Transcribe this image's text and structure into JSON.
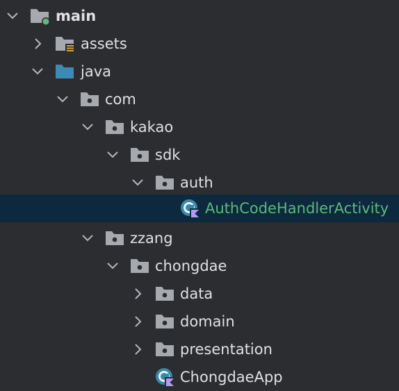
{
  "tree": {
    "main": "main",
    "assets": "assets",
    "java": "java",
    "com": "com",
    "kakao": "kakao",
    "sdk": "sdk",
    "auth": "auth",
    "auth_activity": "AuthCodeHandlerActivity",
    "zzang": "zzang",
    "chongdae": "chongdae",
    "data": "data",
    "domain": "domain",
    "presentation": "presentation",
    "app": "ChongdaeApp"
  },
  "colors": {
    "background": "#2b2d30",
    "selected_row": "#0d293e",
    "text": "#dfe1e5",
    "selected_text": "#5fb878",
    "folder": "#a6a9ad",
    "source_folder": "#3d8bb4",
    "kotlin_badge": "#b39bf2"
  },
  "icons": {
    "expanded": "chevron-down-icon",
    "collapsed": "chevron-right-icon",
    "module_folder": "module-folder-icon",
    "resources_folder": "resources-folder-icon",
    "source_folder": "source-root-folder-icon",
    "package": "package-folder-icon",
    "kotlin_class": "kotlin-class-icon"
  }
}
